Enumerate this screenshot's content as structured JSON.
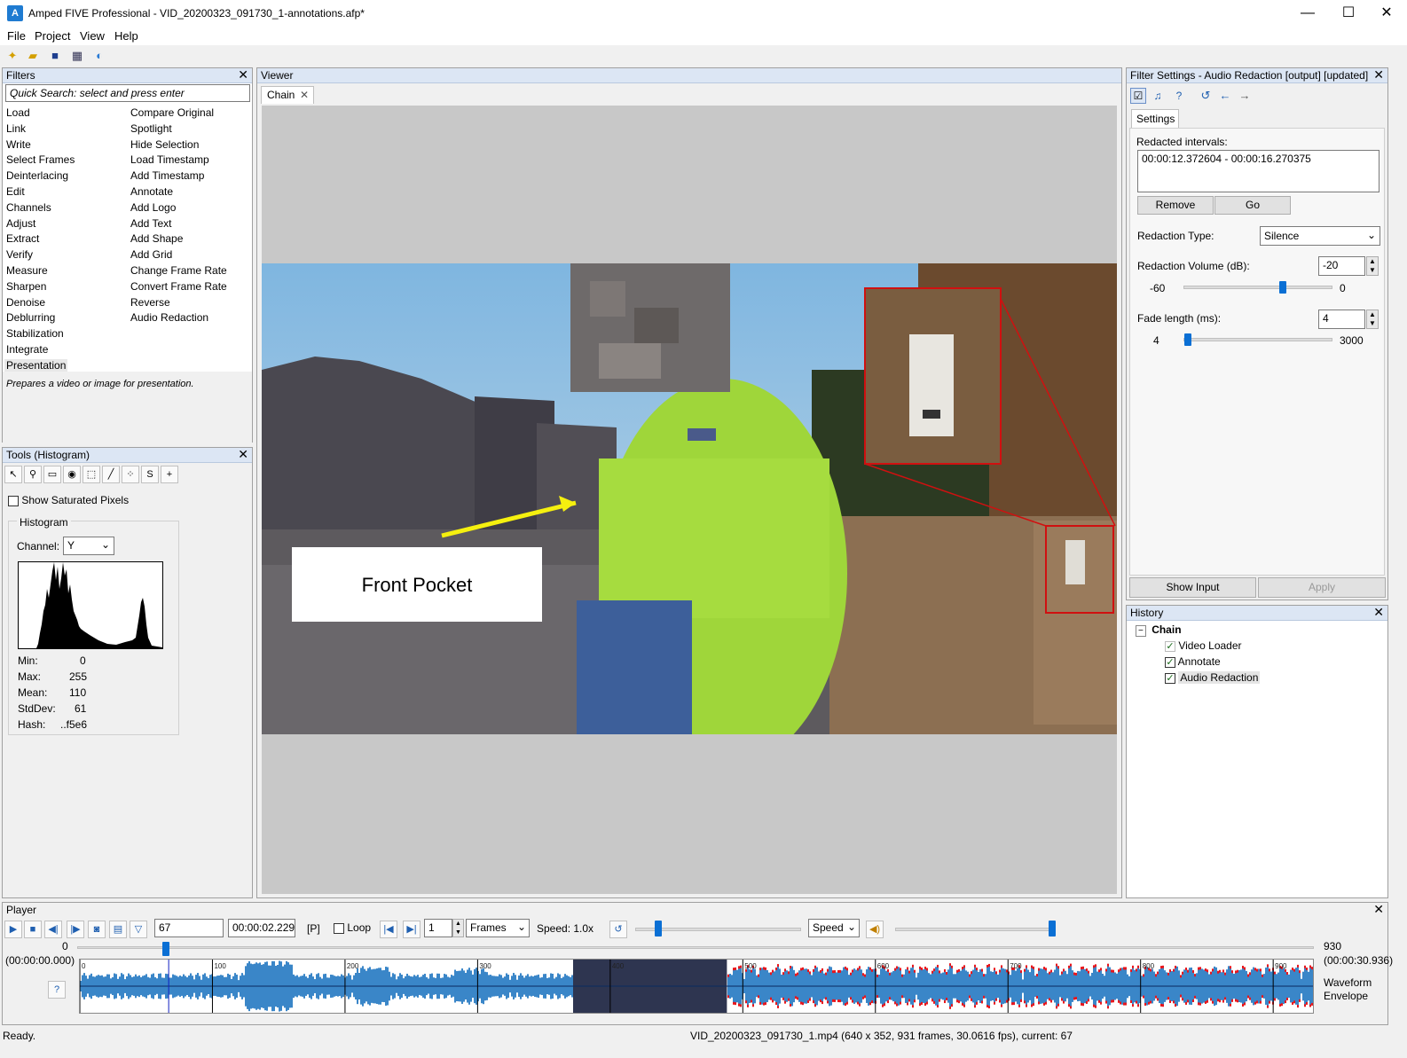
{
  "window": {
    "app_icon": "A",
    "title": "Amped FIVE Professional - VID_20200323_091730_1-annotations.afp*",
    "controls": {
      "minimize": "—",
      "maximize": "☐",
      "close": "✕"
    }
  },
  "menu": {
    "items": [
      "File",
      "Project",
      "View",
      "Help"
    ]
  },
  "toolbar": {
    "icons": [
      "new-project-icon",
      "open-folder-icon",
      "save-icon",
      "film-icon",
      "update-icon"
    ]
  },
  "filters": {
    "title": "Filters",
    "search_placeholder": "Quick Search: select and press enter",
    "categories_left": [
      "Load",
      "Link",
      "Write",
      "Select Frames",
      "Deinterlacing",
      "Edit",
      "Channels",
      "Adjust",
      "Extract",
      "Verify",
      "Measure",
      "Sharpen",
      "Denoise",
      "Deblurring",
      "Stabilization",
      "Integrate",
      "Presentation"
    ],
    "categories_right": [
      "Compare Original",
      "Spotlight",
      "Hide Selection",
      "Load Timestamp",
      "Add Timestamp",
      "Annotate",
      "Add Logo",
      "Add Text",
      "Add Shape",
      "Add Grid",
      "Change Frame Rate",
      "Convert Frame Rate",
      "Reverse",
      "Audio Redaction"
    ],
    "selected": "Presentation",
    "description": "Prepares a video or image for presentation."
  },
  "tools": {
    "title": "Tools (Histogram)",
    "show_saturated_label": "Show Saturated Pixels",
    "show_saturated_checked": false,
    "histogram_group_label": "Histogram",
    "channel_label": "Channel:",
    "channel_value": "Y",
    "stats": {
      "min_label": "Min:",
      "min_value": "0",
      "max_label": "Max:",
      "max_value": "255",
      "mean_label": "Mean:",
      "mean_value": "110",
      "stddev_label": "StdDev:",
      "stddev_value": "61",
      "hash_label": "Hash:",
      "hash_value": "..f5e6"
    }
  },
  "viewer": {
    "title": "Viewer",
    "tab_label": "Chain",
    "annotation_text": "Front Pocket"
  },
  "filter_settings": {
    "title": "Filter Settings - Audio Redaction [output] [updated]",
    "tab_label": "Settings",
    "redacted_intervals_label": "Redacted intervals:",
    "intervals": [
      "00:00:12.372604 - 00:00:16.270375"
    ],
    "remove_button": "Remove",
    "go_button": "Go",
    "redaction_type_label": "Redaction Type:",
    "redaction_type_value": "Silence",
    "redaction_volume_label": "Redaction Volume (dB):",
    "redaction_volume_value": "-20",
    "volume_min": "-60",
    "volume_max": "0",
    "volume_level": 0.667,
    "fade_length_label": "Fade length (ms):",
    "fade_length_value": "4",
    "fade_min": "4",
    "fade_max": "3000",
    "fade_level": 0.0,
    "show_input_button": "Show Input",
    "apply_button": "Apply"
  },
  "history": {
    "title": "History",
    "root": "Chain",
    "items": [
      {
        "label": "Video Loader",
        "checked": true,
        "enabled": false
      },
      {
        "label": "Annotate",
        "checked": true,
        "enabled": true
      },
      {
        "label": "Audio Redaction",
        "checked": true,
        "enabled": true
      }
    ]
  },
  "player": {
    "title": "Player",
    "frame_value": "67",
    "time_value": "00:00:02.229",
    "p_label": "[P]",
    "loop_label": "Loop",
    "loop_checked": false,
    "step_value": "1",
    "step_unit": "Frames",
    "speed_text": "Speed: 1.0x",
    "speed_select": "Speed",
    "start_frame": "0",
    "end_frame": "930",
    "start_time": "(00:00:00.000)",
    "end_time": "(00:00:30.936)",
    "waveform_ticks": [
      "0",
      "100",
      "200",
      "300",
      "400",
      "500",
      "600",
      "700",
      "800",
      "900"
    ],
    "waveform_mode": "Waveform Envelope",
    "current_frame": 67,
    "total_frames": 930,
    "redacted_frames": [
      372,
      488
    ]
  },
  "status": {
    "left": "Ready.",
    "right": "VID_20200323_091730_1.mp4 (640 x 352, 931 frames, 30.0616 fps), current: 67"
  }
}
